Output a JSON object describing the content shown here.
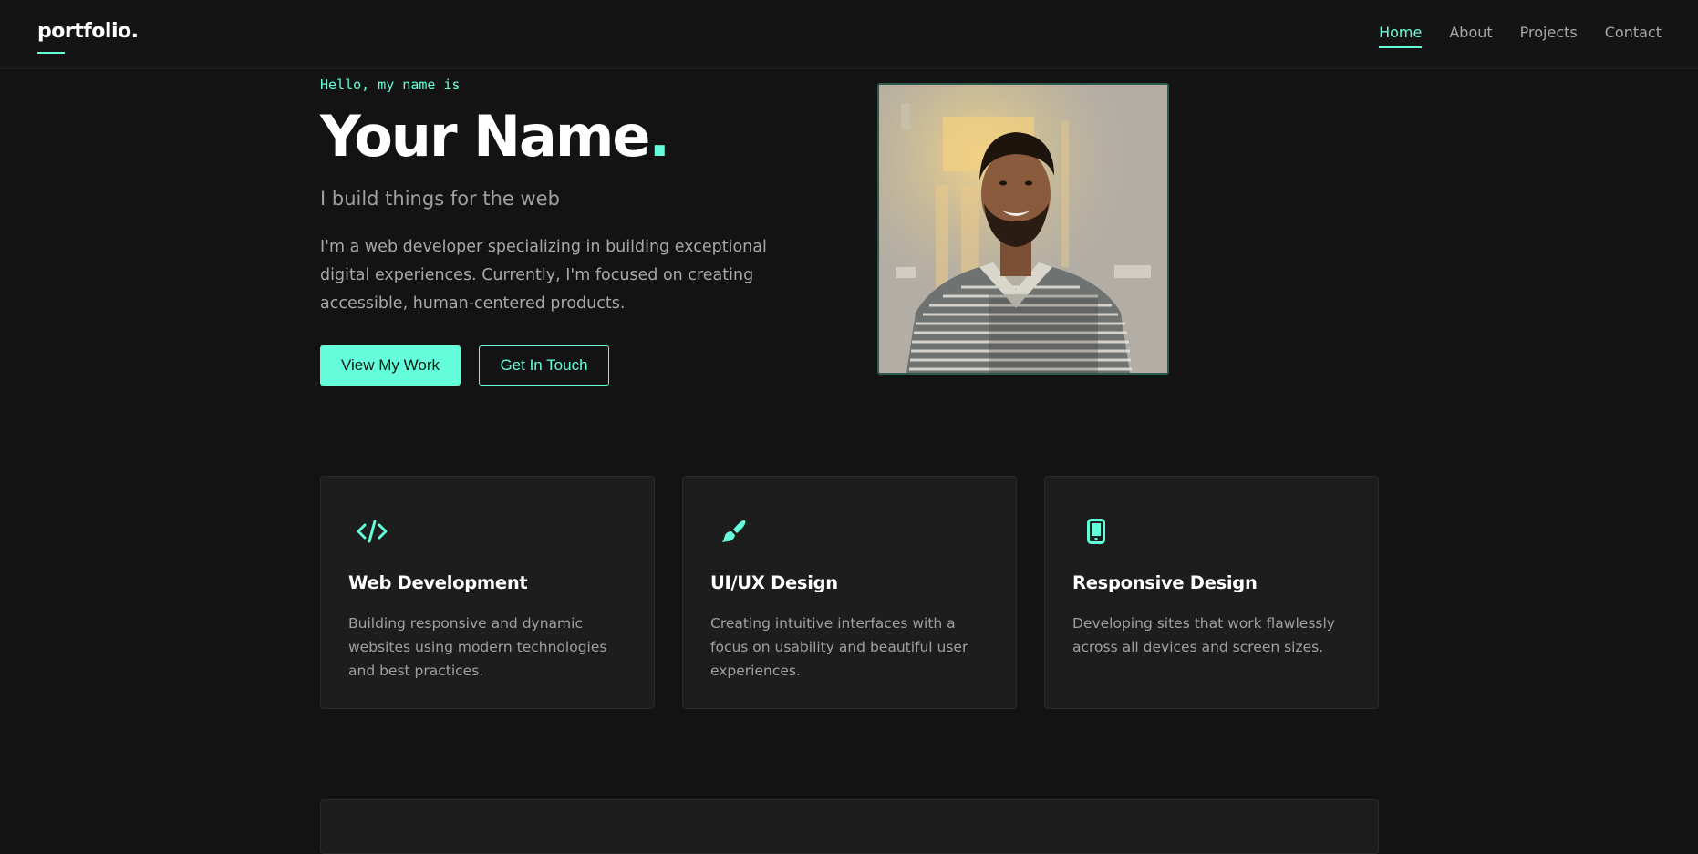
{
  "header": {
    "logo": "portfolio.",
    "nav": [
      {
        "label": "Home",
        "active": true
      },
      {
        "label": "About",
        "active": false
      },
      {
        "label": "Projects",
        "active": false
      },
      {
        "label": "Contact",
        "active": false
      }
    ]
  },
  "hero": {
    "greeting": "Hello, my name is",
    "name": "Your Name",
    "name_suffix": ".",
    "tagline": "I build things for the web",
    "bio": "I'm a web developer specializing in building exceptional digital experiences. Currently, I'm focused on creating accessible, human-centered products.",
    "primary_button": "View My Work",
    "secondary_button": "Get In Touch"
  },
  "services": [
    {
      "icon": "code-icon",
      "title": "Web Development",
      "description": "Building responsive and dynamic websites using modern technologies and best practices."
    },
    {
      "icon": "paintbrush-icon",
      "title": "UI/UX Design",
      "description": "Creating intuitive interfaces with a focus on usability and beautiful user experiences."
    },
    {
      "icon": "mobile-icon",
      "title": "Responsive Design",
      "description": "Developing sites that work flawlessly across all devices and screen sizes."
    }
  ],
  "colors": {
    "accent": "#64ffda",
    "background": "#131313",
    "card": "#1d1d1d",
    "text_muted": "#a8a8a8"
  }
}
